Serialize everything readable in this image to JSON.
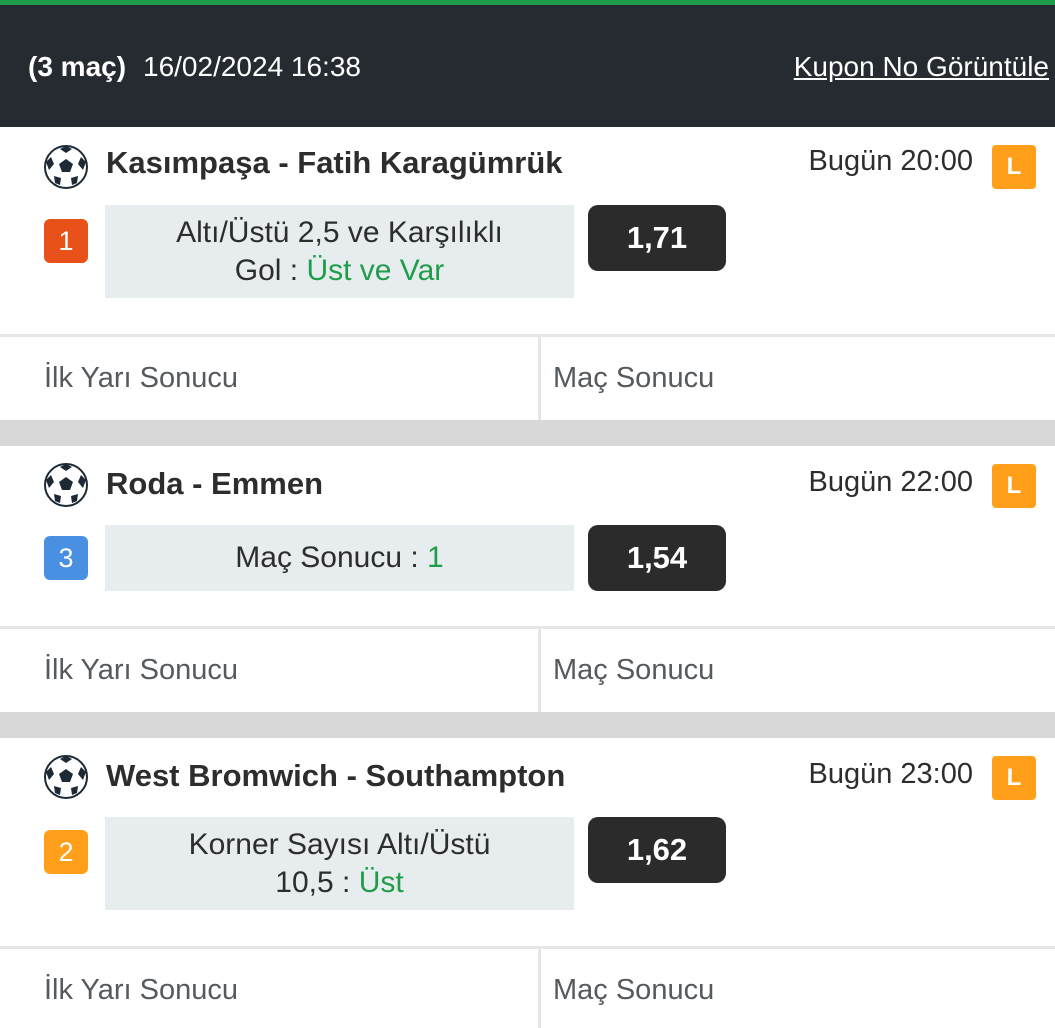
{
  "header": {
    "match_count": "(3 maç)",
    "datetime": "16/02/2024 16:38",
    "view_coupon_link": "Kupon No Görüntüle"
  },
  "colors": {
    "header_bg": "#252b30",
    "accent_green": "#1f9d4a",
    "live_orange": "#ff9f1a",
    "badge_red": "#e8511a",
    "badge_blue": "#4a90e2",
    "badge_orange": "#ff9f1a",
    "odd_bg": "#2b2b2b",
    "bet_bg": "#e7ecee"
  },
  "matches": [
    {
      "teams": "Kasımpaşa - Fatih Karagümrük",
      "time": "Bugün 20:00",
      "live_badge": "L",
      "sport_icon": "football-icon",
      "index_badge": "1",
      "bet_market_line1": "Altı/Üstü 2,5 ve Karşılıklı",
      "bet_market_line2": "Gol : ",
      "bet_pick": "Üst ve Var",
      "odd": "1,71",
      "tab_left": "İlk Yarı Sonucu",
      "tab_right": "Maç Sonucu"
    },
    {
      "teams": "Roda - Emmen",
      "time": "Bugün 22:00",
      "live_badge": "L",
      "sport_icon": "football-icon",
      "index_badge": "3",
      "bet_market_line1": "Maç Sonucu : ",
      "bet_pick": "1",
      "odd": "1,54",
      "tab_left": "İlk Yarı Sonucu",
      "tab_right": "Maç Sonucu"
    },
    {
      "teams": "West Bromwich - Southampton",
      "time": "Bugün 23:00",
      "live_badge": "L",
      "sport_icon": "football-icon",
      "index_badge": "2",
      "bet_market_line1": "Korner Sayısı Altı/Üstü",
      "bet_market_line2": "10,5 : ",
      "bet_pick": "Üst",
      "odd": "1,62",
      "tab_left": "İlk Yarı Sonucu",
      "tab_right": "Maç Sonucu"
    }
  ]
}
